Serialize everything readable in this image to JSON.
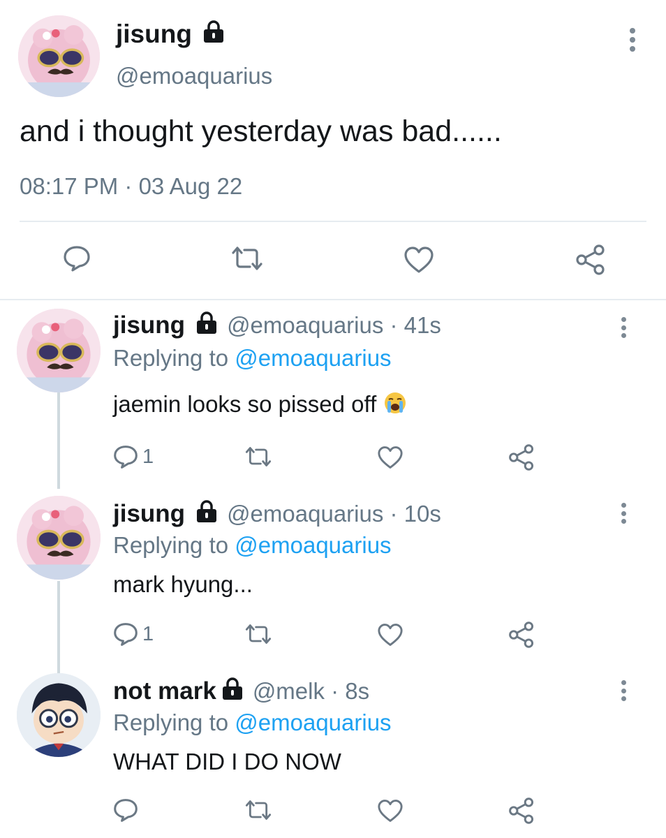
{
  "main_tweet": {
    "name": "jisung",
    "handle": "@emoaquarius",
    "text": "and i thought yesterday was bad......",
    "meta": "08:17 PM · 03 Aug 22"
  },
  "replies": [
    {
      "name": "jisung",
      "handle_time": "@emoaquarius · 41s",
      "replying_prefix": "Replying to ",
      "replying_to": "@emoaquarius",
      "text": "jaemin looks so pissed off",
      "reply_count": "1",
      "emoji": "loudly-crying-face"
    },
    {
      "name": "jisung",
      "handle_time": "@emoaquarius · 10s",
      "replying_prefix": "Replying to ",
      "replying_to": "@emoaquarius",
      "text": "mark hyung...",
      "reply_count": "1"
    },
    {
      "name": "not mark",
      "handle_time": "@melk · 8s",
      "replying_prefix": "Replying to ",
      "replying_to": "@emoaquarius",
      "text": "WHAT DID I DO NOW",
      "reply_count": ""
    }
  ],
  "colors": {
    "text": "#14171a",
    "secondary": "#657786",
    "accent": "#1da1f2",
    "icon": "#6b7884",
    "divider": "#e6ecf0"
  },
  "icons": {
    "reply": "speech-bubble-icon",
    "retweet": "retweet-icon",
    "like": "heart-icon",
    "share": "share-icon",
    "protected": "lock-icon",
    "more": "more-vertical-icon"
  }
}
